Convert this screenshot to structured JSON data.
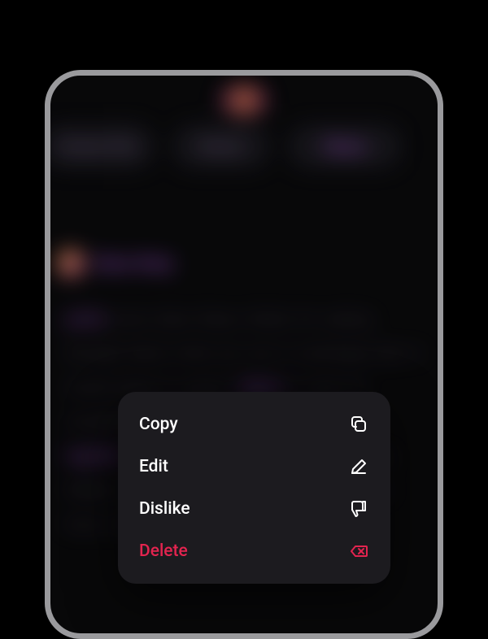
{
  "bg": {
    "pill_a": "Scene File",
    "pill_b": "Reset",
    "pill_c": "Share",
    "author": "Dara Grey"
  },
  "menu": {
    "copy": {
      "label": "Copy"
    },
    "edit": {
      "label": "Edit"
    },
    "dislike": {
      "label": "Dislike"
    },
    "delete": {
      "label": "Delete"
    }
  }
}
